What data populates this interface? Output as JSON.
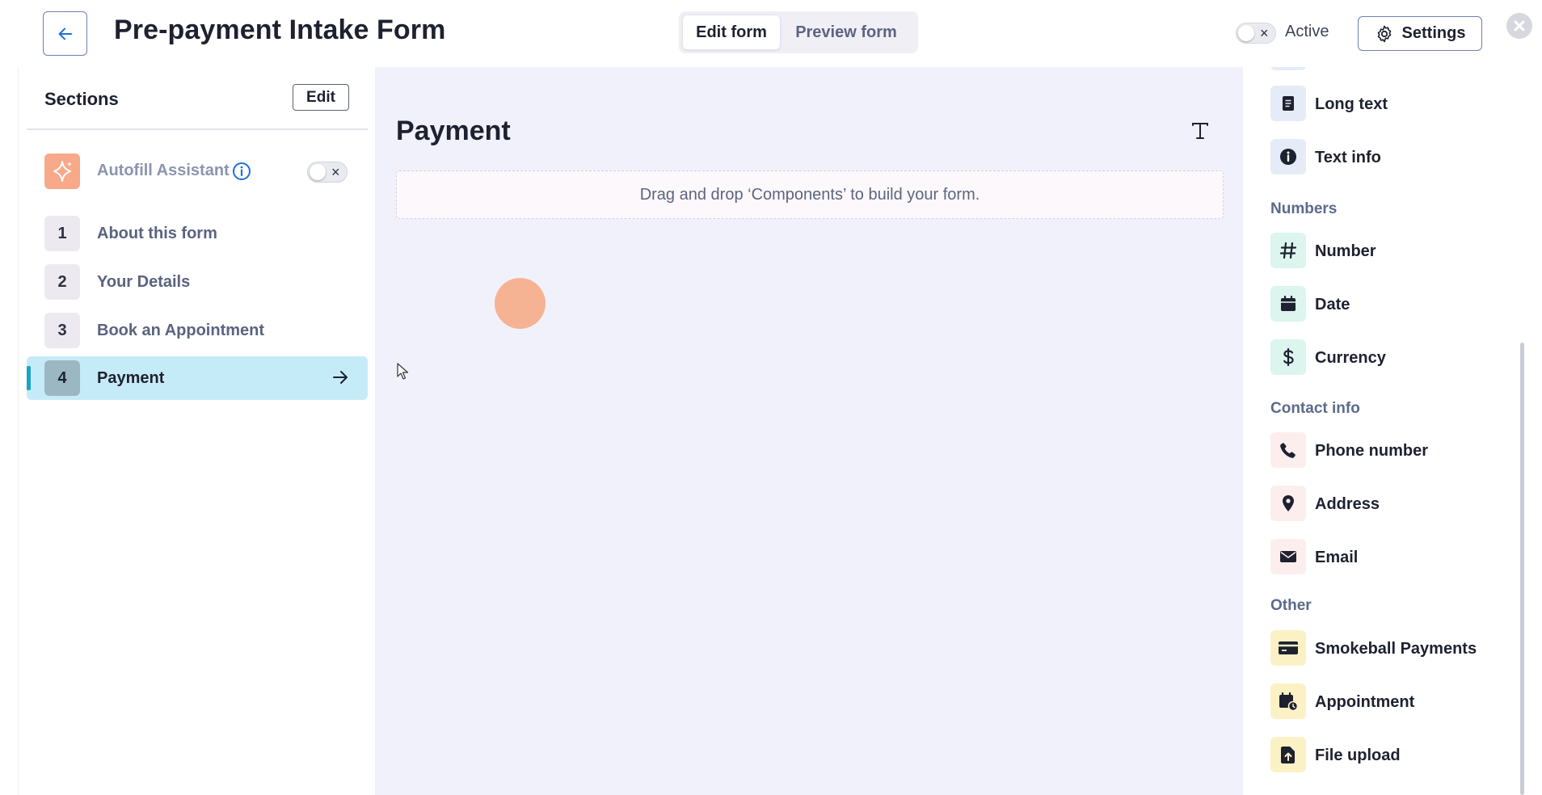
{
  "header": {
    "title": "Pre-payment Intake Form",
    "tabs": [
      {
        "label": "Edit form"
      },
      {
        "label": "Preview form"
      }
    ],
    "active_label": "Active",
    "settings_label": "Settings"
  },
  "sidebar": {
    "title": "Sections",
    "edit_label": "Edit",
    "autofill_label": "Autofill Assistant",
    "sections": [
      {
        "num": "1",
        "label": "About this form"
      },
      {
        "num": "2",
        "label": "Your Details"
      },
      {
        "num": "3",
        "label": "Book an Appointment"
      },
      {
        "num": "4",
        "label": "Payment"
      }
    ]
  },
  "canvas": {
    "title": "Payment",
    "dropzone_text": "Drag and drop ‘Components’ to build your form."
  },
  "components": {
    "items_top": [
      {
        "label": "Long text",
        "icon": "long-text-icon"
      },
      {
        "label": "Text info",
        "icon": "info-icon"
      }
    ],
    "numbers_heading": "Numbers",
    "numbers": [
      {
        "label": "Number",
        "icon": "hash-icon"
      },
      {
        "label": "Date",
        "icon": "calendar-icon"
      },
      {
        "label": "Currency",
        "icon": "dollar-icon"
      }
    ],
    "contact_heading": "Contact info",
    "contact": [
      {
        "label": "Phone number",
        "icon": "phone-icon"
      },
      {
        "label": "Address",
        "icon": "location-pin-icon"
      },
      {
        "label": "Email",
        "icon": "envelope-icon"
      }
    ],
    "other_heading": "Other",
    "other": [
      {
        "label": "Smokeball Payments",
        "icon": "credit-card-icon"
      },
      {
        "label": "Appointment",
        "icon": "calendar-clock-icon"
      },
      {
        "label": "File upload",
        "icon": "file-upload-icon"
      }
    ]
  },
  "colors": {
    "accent": "#1aa3c8",
    "selected_bg": "#c6ebf8",
    "canvas_bg": "#f1f1fb",
    "autofill_orange": "#f7a98a"
  }
}
